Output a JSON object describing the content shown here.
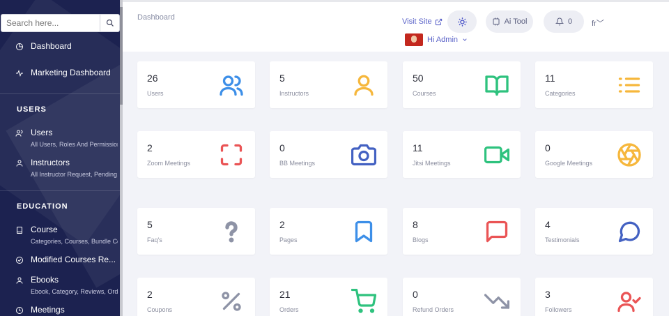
{
  "sidebar": {
    "search_placeholder": "Search here...",
    "items": [
      {
        "label": "Dashboard"
      },
      {
        "label": "Marketing Dashboard"
      }
    ],
    "section_users": "USERS",
    "users": {
      "label": "Users",
      "sub": "All Users, Roles And Permission"
    },
    "instructors": {
      "label": "Instructors",
      "sub": "All Instructor Request, Pending..."
    },
    "section_education": "EDUCATION",
    "course": {
      "label": "Course",
      "sub": "Categories, Courses, Bundle Co..."
    },
    "modified": {
      "label": "Modified Courses Re..."
    },
    "ebooks": {
      "label": "Ebooks",
      "sub": "Ebook, Category, Reviews, Orde..."
    },
    "meetings": {
      "label": "Meetings"
    }
  },
  "topbar": {
    "breadcrumb": "Dashboard",
    "visit_site": "Visit Site",
    "ai_tool": "Ai Tool",
    "notifications": "0",
    "lang": "fr",
    "admin": "Hi Admin"
  },
  "cards": [
    {
      "value": "26",
      "label": "Users",
      "icon": "users-icon",
      "color": "#3d8fe8"
    },
    {
      "value": "5",
      "label": "Instructors",
      "icon": "user-icon",
      "color": "#f6b73c"
    },
    {
      "value": "50",
      "label": "Courses",
      "icon": "book-open-icon",
      "color": "#2ec27e"
    },
    {
      "value": "11",
      "label": "Categories",
      "icon": "list-icon",
      "color": "#f6b73c"
    },
    {
      "value": "2",
      "label": "Zoom Meetings",
      "icon": "maximize-icon",
      "color": "#ea5455"
    },
    {
      "value": "0",
      "label": "BB Meetings",
      "icon": "camera-icon",
      "color": "#4361c2"
    },
    {
      "value": "11",
      "label": "Jitsi Meetings",
      "icon": "video-icon",
      "color": "#2ec27e"
    },
    {
      "value": "0",
      "label": "Google Meetings",
      "icon": "aperture-icon",
      "color": "#f6b73c"
    },
    {
      "value": "5",
      "label": "Faq's",
      "icon": "question-icon",
      "color": "#8e93a6"
    },
    {
      "value": "2",
      "label": "Pages",
      "icon": "bookmark-icon",
      "color": "#3d8fe8"
    },
    {
      "value": "8",
      "label": "Blogs",
      "icon": "message-square-icon",
      "color": "#ea5455"
    },
    {
      "value": "4",
      "label": "Testimonials",
      "icon": "message-circle-icon",
      "color": "#4361c2"
    },
    {
      "value": "2",
      "label": "Coupons",
      "icon": "percent-icon",
      "color": "#8e93a6"
    },
    {
      "value": "21",
      "label": "Orders",
      "icon": "cart-icon",
      "color": "#2ec27e"
    },
    {
      "value": "0",
      "label": "Refund Orders",
      "icon": "trending-down-icon",
      "color": "#8e93a6"
    },
    {
      "value": "3",
      "label": "Followers",
      "icon": "user-check-icon",
      "color": "#ea5455"
    }
  ]
}
